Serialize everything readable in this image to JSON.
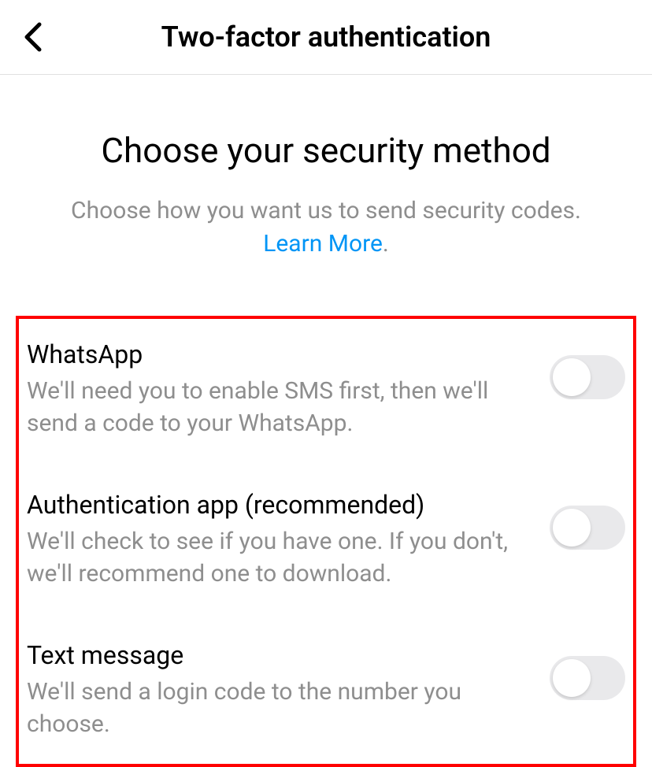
{
  "header": {
    "title": "Two-factor authentication"
  },
  "section": {
    "title": "Choose your security method",
    "subtitle_prefix": "Choose how you want us to send security codes. ",
    "learn_more": "Learn More",
    "subtitle_suffix": "."
  },
  "methods": [
    {
      "title": "WhatsApp",
      "description": "We'll need you to enable SMS first, then we'll send a code to your WhatsApp.",
      "enabled": false
    },
    {
      "title": "Authentication app (recommended)",
      "description": "We'll check to see if you have one. If you don't, we'll recommend one to download.",
      "enabled": false
    },
    {
      "title": "Text message",
      "description": "We'll send a login code to the number you choose.",
      "enabled": false
    }
  ]
}
